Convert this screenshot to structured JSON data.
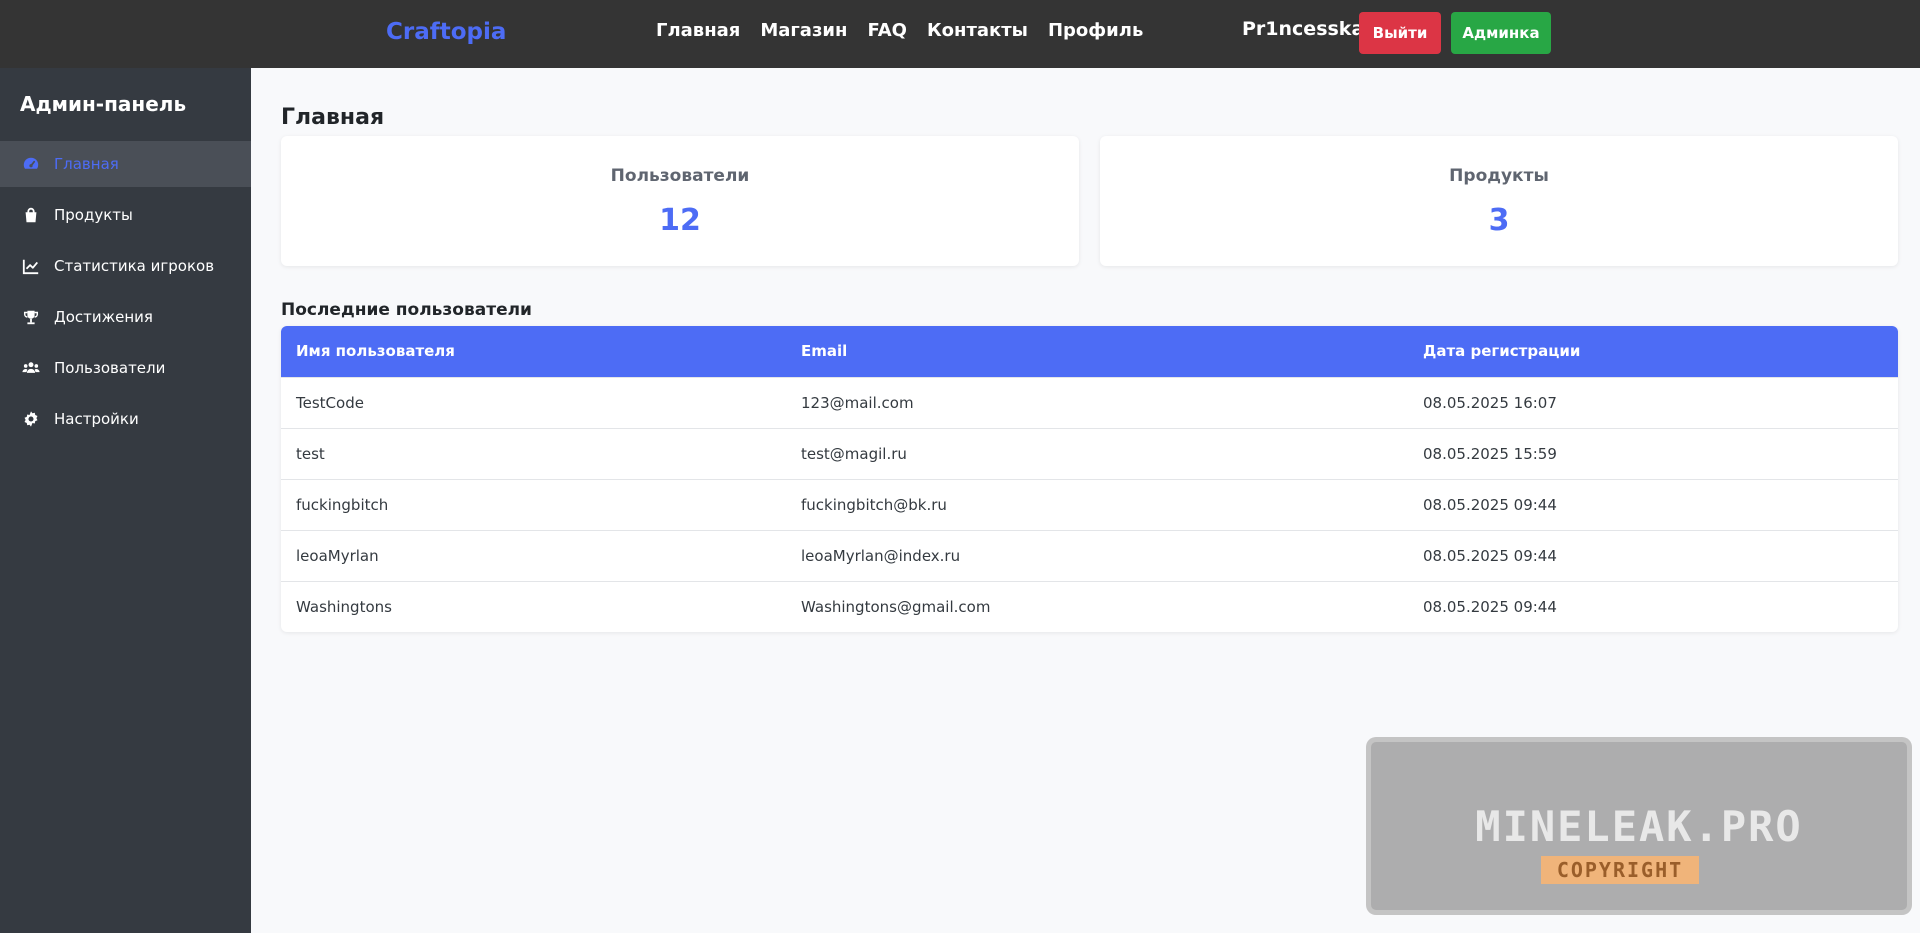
{
  "header": {
    "brand": "Craftopia",
    "nav": [
      "Главная",
      "Магазин",
      "FAQ",
      "Контакты",
      "Профиль"
    ],
    "username": "Pr1ncesska",
    "logout_label": "Выйти",
    "admin_label": "Админка"
  },
  "sidebar": {
    "title": "Админ-панель",
    "items": [
      {
        "label": "Главная",
        "icon": "dashboard-icon",
        "active": true
      },
      {
        "label": "Продукты",
        "icon": "shopping-bag-icon",
        "active": false
      },
      {
        "label": "Статистика игроков",
        "icon": "chart-line-icon",
        "active": false
      },
      {
        "label": "Достижения",
        "icon": "trophy-icon",
        "active": false
      },
      {
        "label": "Пользователи",
        "icon": "users-icon",
        "active": false
      },
      {
        "label": "Настройки",
        "icon": "gear-icon",
        "active": false
      }
    ]
  },
  "main": {
    "title": "Главная",
    "cards": [
      {
        "label": "Пользователи",
        "value": "12"
      },
      {
        "label": "Продукты",
        "value": "3"
      }
    ],
    "recent_users_title": "Последние пользователи",
    "table": {
      "headers": [
        "Имя пользователя",
        "Email",
        "Дата регистрации"
      ],
      "rows": [
        [
          "TestCode",
          "123@mail.com",
          "08.05.2025 16:07"
        ],
        [
          "test",
          "test@magil.ru",
          "08.05.2025 15:59"
        ],
        [
          "fuckingbitch",
          "fuckingbitch@bk.ru",
          "08.05.2025 09:44"
        ],
        [
          "leoaMyrlan",
          "leoaMyrlan@index.ru",
          "08.05.2025 09:44"
        ],
        [
          "Washingtons",
          "Washingtons@gmail.com",
          "08.05.2025 09:44"
        ]
      ]
    }
  },
  "watermark": {
    "main": "MINELEAK.PRO",
    "sub": "COPYRIGHT"
  },
  "colors": {
    "accent": "#4d6cf5",
    "topbar": "#343434",
    "sidebar": "#353a41",
    "logout": "#dc3545",
    "admin": "#28a745"
  }
}
